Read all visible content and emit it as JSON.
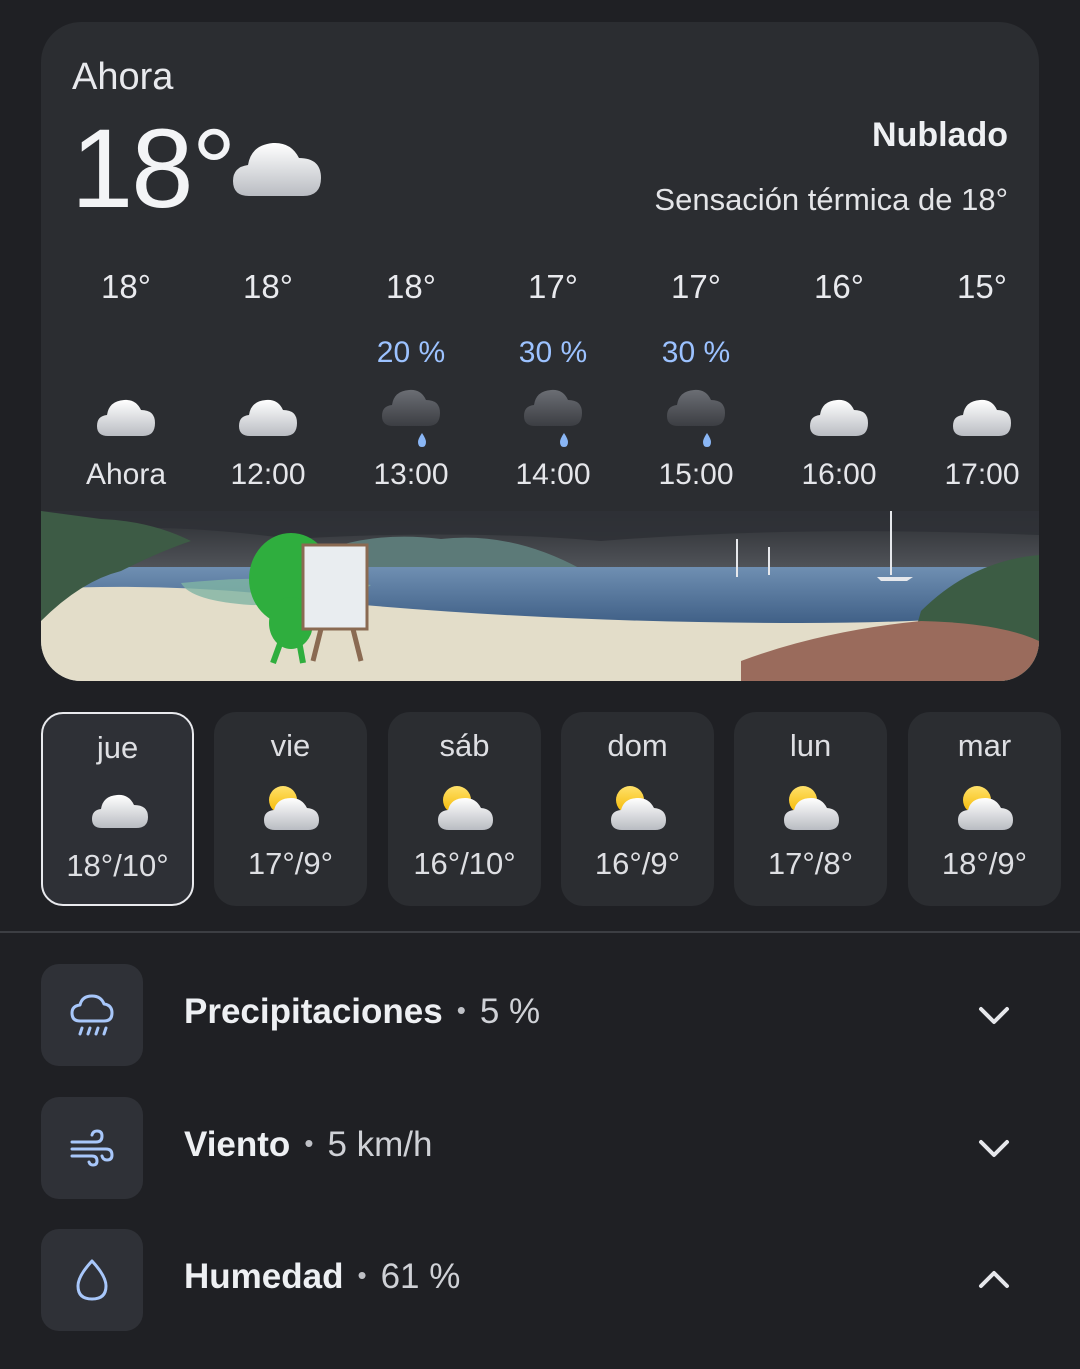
{
  "current": {
    "label": "Ahora",
    "temperature": "18°",
    "icon": "cloud-icon",
    "condition": "Nublado",
    "feels_like": "Sensación térmica de 18°"
  },
  "hourly": [
    {
      "temp": "18°",
      "precip": "",
      "time": "Ahora",
      "icon": "cloud-icon"
    },
    {
      "temp": "18°",
      "precip": "",
      "time": "12:00",
      "icon": "cloud-icon"
    },
    {
      "temp": "18°",
      "precip": "20 %",
      "time": "13:00",
      "icon": "rain-cloud-icon"
    },
    {
      "temp": "17°",
      "precip": "30 %",
      "time": "14:00",
      "icon": "rain-cloud-icon"
    },
    {
      "temp": "17°",
      "precip": "30 %",
      "time": "15:00",
      "icon": "rain-cloud-icon"
    },
    {
      "temp": "16°",
      "precip": "",
      "time": "16:00",
      "icon": "cloud-icon"
    },
    {
      "temp": "15°",
      "precip": "",
      "time": "17:00",
      "icon": "cloud-icon"
    }
  ],
  "daily": [
    {
      "day": "jue",
      "range": "18°/10°",
      "icon": "cloud-icon",
      "selected": true
    },
    {
      "day": "vie",
      "range": "17°/9°",
      "icon": "partly-sunny-icon"
    },
    {
      "day": "sáb",
      "range": "16°/10°",
      "icon": "partly-sunny-icon"
    },
    {
      "day": "dom",
      "range": "16°/9°",
      "icon": "partly-sunny-icon"
    },
    {
      "day": "lun",
      "range": "17°/8°",
      "icon": "partly-sunny-icon"
    },
    {
      "day": "mar",
      "range": "18°/9°",
      "icon": "partly-sunny-icon"
    }
  ],
  "details": [
    {
      "label": "Precipitaciones",
      "value": "5 %",
      "icon": "rain-cloud-outline-icon",
      "expanded": false
    },
    {
      "label": "Viento",
      "value": "5 km/h",
      "icon": "wind-icon",
      "expanded": false
    },
    {
      "label": "Humedad",
      "value": "61 %",
      "icon": "droplet-icon",
      "expanded": true
    }
  ],
  "colors": {
    "background": "#1f2024",
    "card": "#2b2d31",
    "precip_blue": "#9cc2ff",
    "accent_icon": "#a8c7fa"
  }
}
